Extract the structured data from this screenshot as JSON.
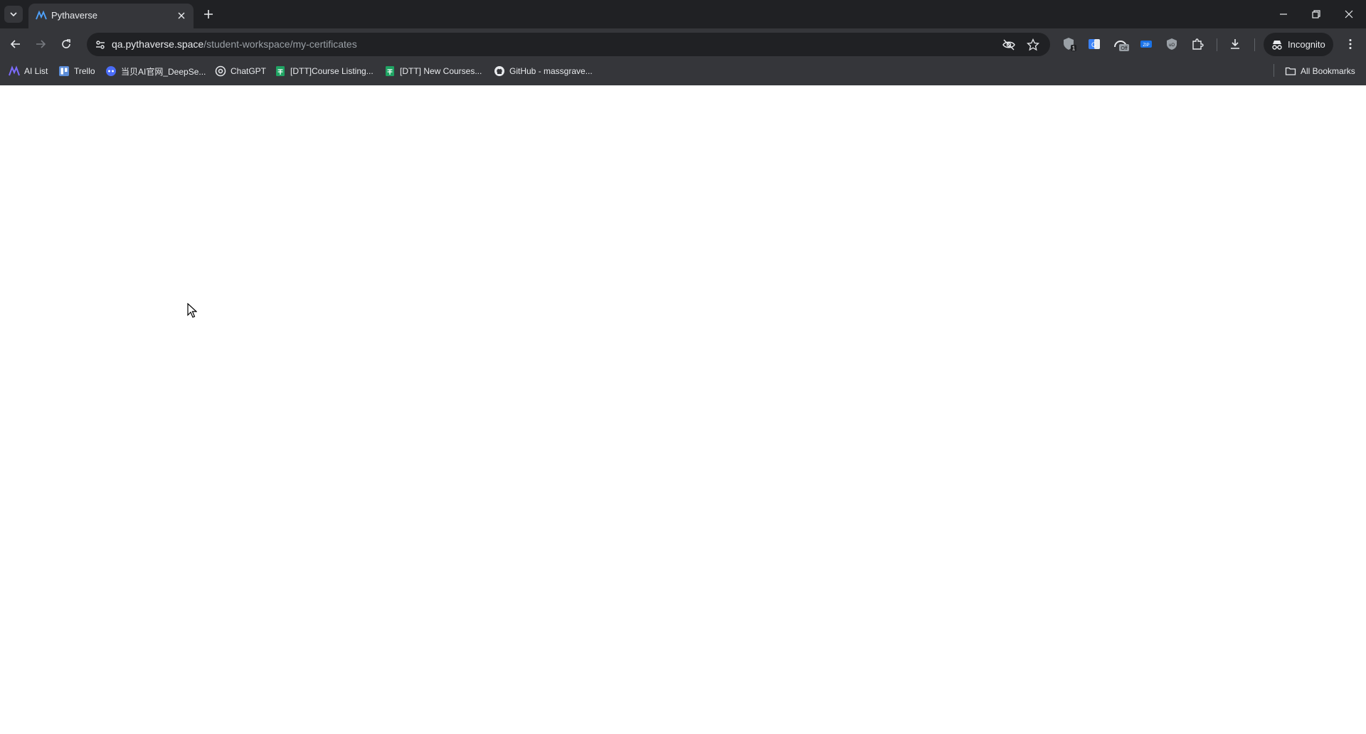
{
  "browser": {
    "tab": {
      "title": "Pythaverse"
    },
    "url": {
      "host": "qa.pythaverse.space",
      "path": "/student-workspace/my-certificates"
    },
    "extensions": [
      {
        "icon": "shield-icon",
        "badge": "1"
      },
      {
        "icon": "translate-icon"
      },
      {
        "icon": "extension-off-icon",
        "badge": "Off"
      },
      {
        "icon": "zip-icon",
        "label": "ZIP"
      },
      {
        "icon": "ublock-icon"
      },
      {
        "icon": "puzzle-icon"
      }
    ],
    "incognito_label": "Incognito",
    "bookmarks": [
      {
        "label": "AI List",
        "icon": "ai-list-icon"
      },
      {
        "label": "Trello",
        "icon": "trello-icon"
      },
      {
        "label": "当贝AI官网_DeepSe...",
        "icon": "dangbei-icon"
      },
      {
        "label": "ChatGPT",
        "icon": "chatgpt-icon"
      },
      {
        "label": "[DTT]Course Listing...",
        "icon": "sheets-icon"
      },
      {
        "label": "[DTT] New Courses...",
        "icon": "sheets-icon"
      },
      {
        "label": "GitHub - massgrave...",
        "icon": "github-icon"
      }
    ],
    "all_bookmarks_label": "All Bookmarks",
    "colors": {
      "chrome": "#35363a",
      "tabstrip": "#202124",
      "text": "#e8eaed"
    }
  }
}
